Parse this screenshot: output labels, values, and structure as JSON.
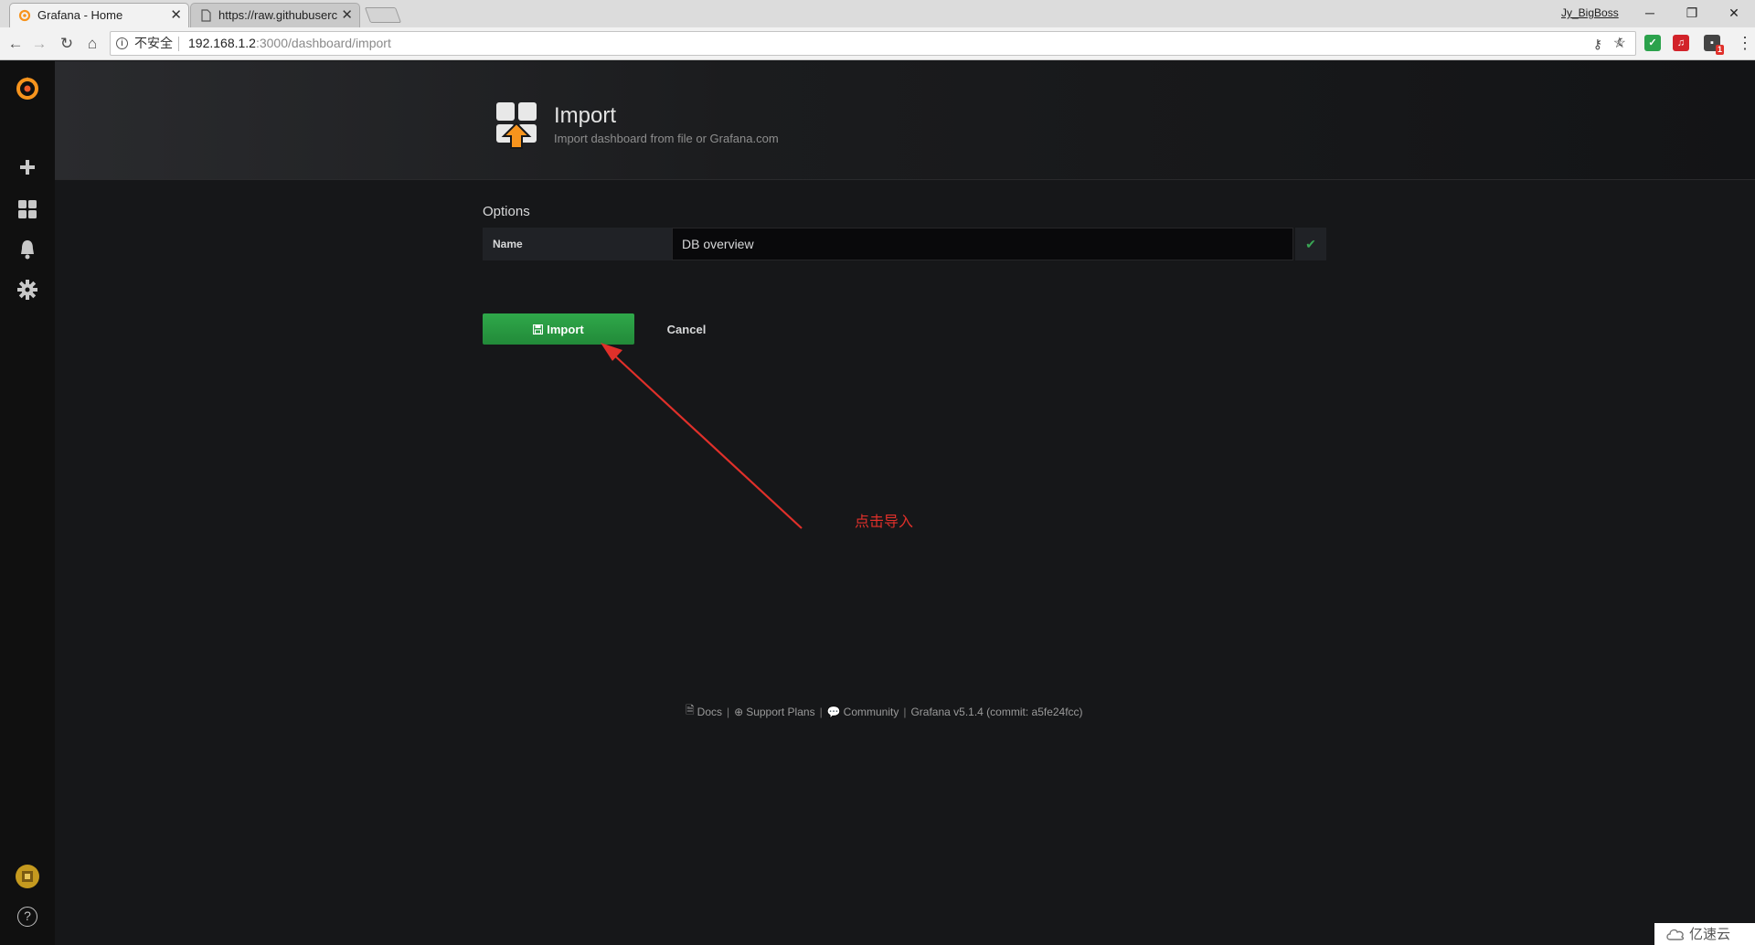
{
  "browser": {
    "tabs": [
      {
        "title": "Grafana - Home",
        "active": true,
        "favicon": "grafana-logo"
      },
      {
        "title": "https://raw.githubuserc",
        "active": false,
        "favicon": "document-icon"
      }
    ],
    "username": "Jy_BigBoss",
    "address": {
      "security_label": "不安全",
      "host": "192.168.1.2",
      "path": ":3000/dashboard/import"
    },
    "extension_badge": "1"
  },
  "sidemenu": {
    "items": [
      "grafana-logo",
      "plus-icon",
      "dashboards-icon",
      "bell-icon",
      "gear-icon",
      "avatar",
      "help-icon"
    ],
    "help_glyph": "?"
  },
  "header": {
    "title": "Import",
    "subtitle": "Import dashboard from file or Grafana.com"
  },
  "options": {
    "section_title": "Options",
    "name_label": "Name",
    "name_value": "DB overview"
  },
  "buttons": {
    "import_label": "Import",
    "cancel_label": "Cancel"
  },
  "annotation": {
    "text": "点击导入",
    "color": "#e0302a"
  },
  "footer": {
    "docs": "Docs",
    "support": "Support Plans",
    "community": "Community",
    "version": "Grafana v5.1.4 (commit: a5fe24fcc)",
    "separator": "|"
  },
  "watermark": {
    "text": "亿速云"
  },
  "colors": {
    "accent_green": "#299c46",
    "grafana_orange": "#f7941d",
    "background": "#161719"
  }
}
